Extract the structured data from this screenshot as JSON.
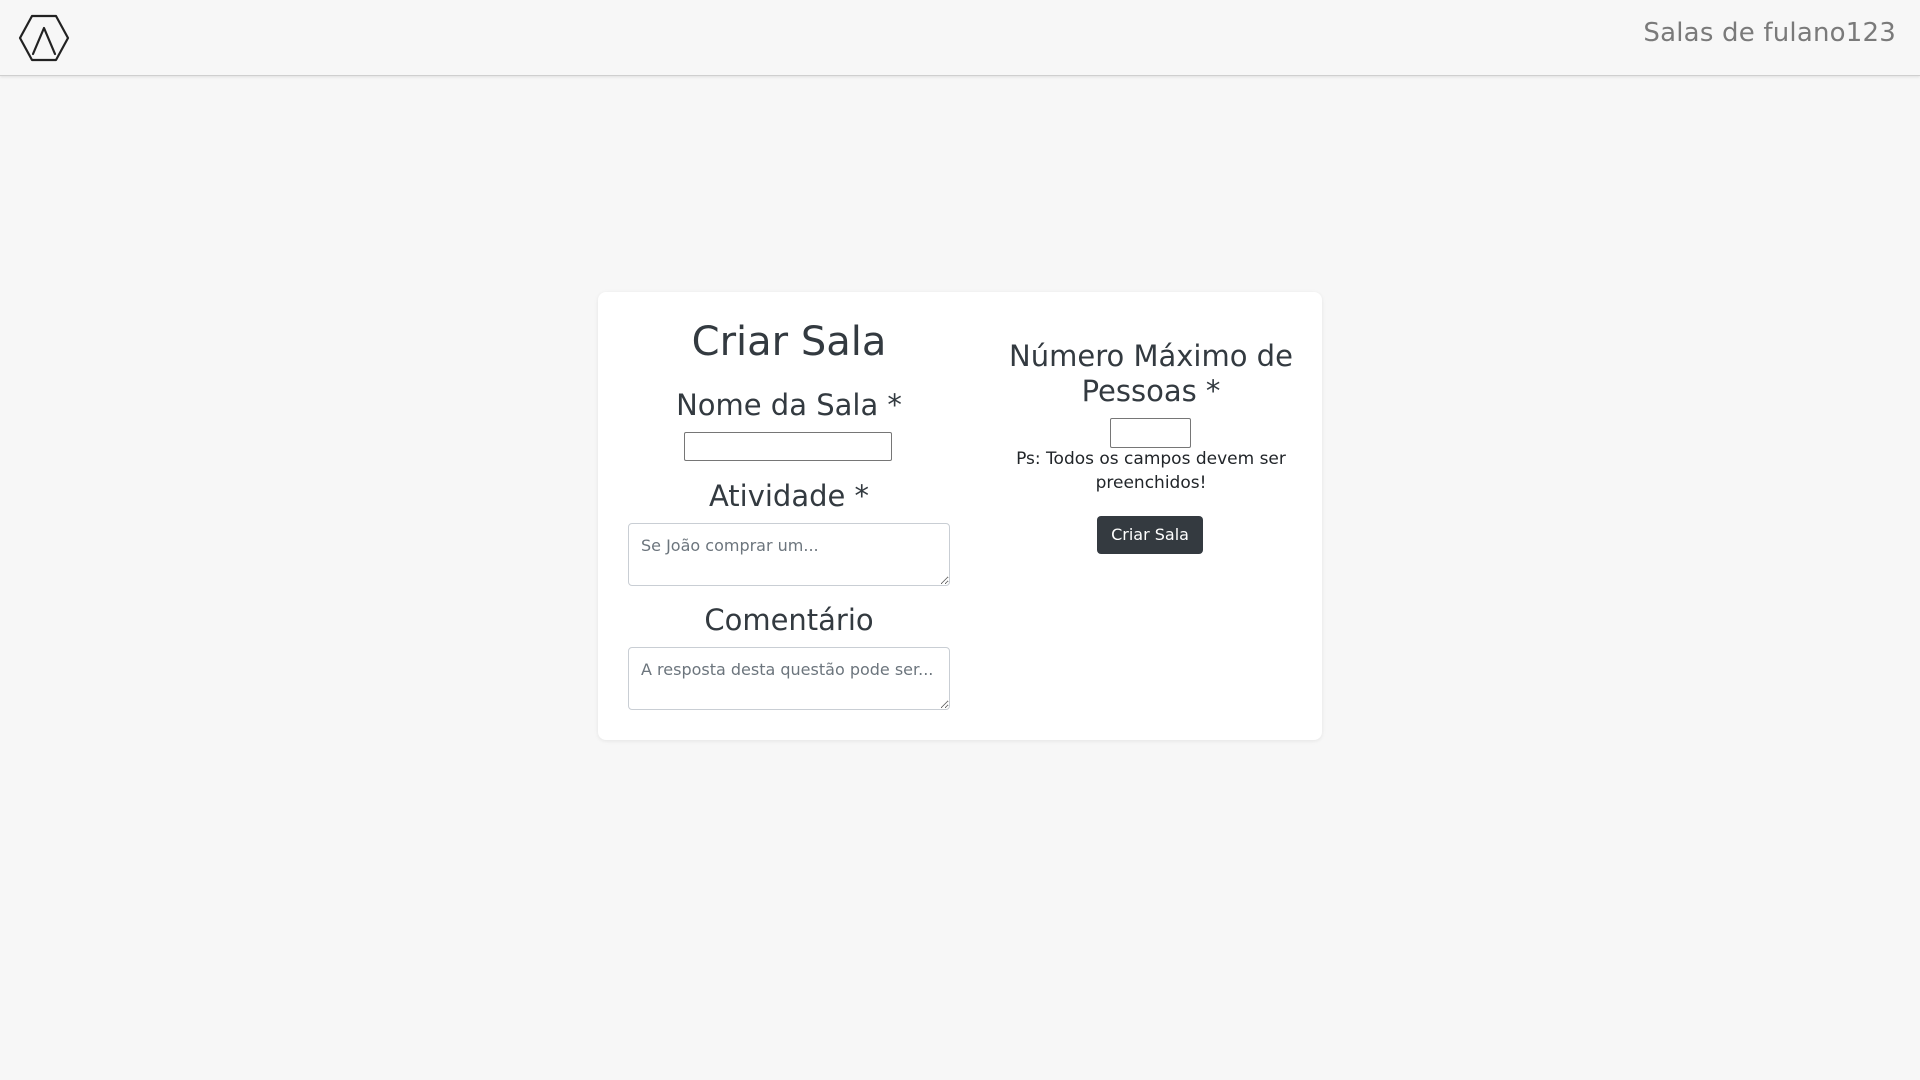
{
  "navbar": {
    "logo_icon": "hexagon-logo-icon",
    "link_label": "Salas de fulano123"
  },
  "form": {
    "title": "Criar Sala",
    "nome_label": "Nome da Sala *",
    "nome_value": "",
    "atividade_label": "Atividade *",
    "atividade_placeholder": "Se João comprar um...",
    "comentario_label": "Comentário",
    "comentario_placeholder": "A resposta desta questão pode ser...",
    "max_label": "Número Máximo de Pessoas *",
    "max_value": "",
    "note": "Ps: Todos os campos devem ser preenchidos!",
    "submit_label": "Criar Sala"
  },
  "colors": {
    "background": "#f7f7f7",
    "card": "#ffffff",
    "button": "#343a40",
    "text": "#333a40"
  }
}
